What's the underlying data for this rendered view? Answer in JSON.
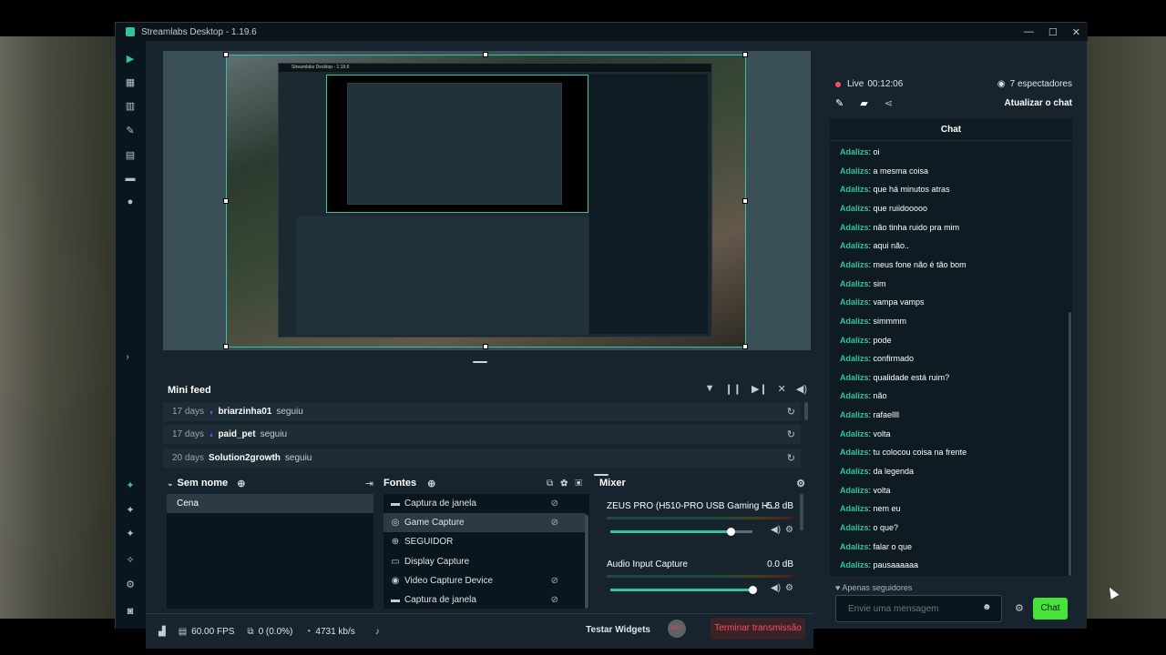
{
  "window": {
    "title": "Streamlabs Desktop - 1.19.6",
    "controls": {
      "minimize": "—",
      "maximize": "☐",
      "close": "✕"
    }
  },
  "leftnav": {
    "top_icons": [
      "editor-icon",
      "themes-icon",
      "layout-icon",
      "alertbox-icon",
      "store-icon",
      "studio-icon",
      "play-icon"
    ],
    "bottom_icons": [
      "stream-settings-icon",
      "multistream-icon",
      "recording-icon",
      "highlighter-icon",
      "settings-icon",
      "profile-icon"
    ]
  },
  "minifeed": {
    "title": "Mini feed",
    "tools": [
      "filter-icon",
      "pause-icon",
      "skip-icon",
      "mute-icon",
      "volume-icon"
    ],
    "rows": [
      {
        "days": "17 days",
        "name": "briarzinha01",
        "action": "seguiu"
      },
      {
        "days": "17 days",
        "name": "paid_pet",
        "action": "seguiu"
      },
      {
        "days": "20 days",
        "name": "Solution2growth",
        "action": "seguiu"
      }
    ]
  },
  "scenes": {
    "title": "Sem nome",
    "items": [
      "Cena"
    ]
  },
  "sources": {
    "title": "Fontes",
    "items": [
      {
        "label": "Captura de janela",
        "icon": "window-icon",
        "hidden": true
      },
      {
        "label": "Game Capture",
        "icon": "gamepad-icon",
        "hidden": true
      },
      {
        "label": "SEGUIDOR",
        "icon": "globe-icon",
        "hidden": false
      },
      {
        "label": "Display Capture",
        "icon": "monitor-icon",
        "hidden": false
      },
      {
        "label": "Video Capture Device",
        "icon": "webcam-icon",
        "hidden": true
      },
      {
        "label": "Captura de janela",
        "icon": "window-icon",
        "hidden": true
      }
    ]
  },
  "mixer": {
    "title": "Mixer",
    "channels": [
      {
        "name": "ZEUS PRO (H510-PRO USB Gaming H...",
        "db": "-5.8 dB",
        "level": 0.85
      },
      {
        "name": "Audio Input Capture",
        "db": "0.0 dB",
        "level": 1.0
      }
    ]
  },
  "statusbar": {
    "fps": "60.00 FPS",
    "dropped": "0 (0.0%)",
    "bitrate": "4731 kb/s",
    "testar_widgets": "Testar Widgets",
    "rec_label": "REC",
    "stop_stream": "Terminar transmissão"
  },
  "chat_panel": {
    "live_label": "Live",
    "live_time": "00:12:06",
    "viewers": "7 espectadores",
    "refresh_label": "Atualizar o chat",
    "chat_title": "Chat",
    "messages": [
      {
        "user": "Adalizs",
        "text": ": oi"
      },
      {
        "user": "Adalizs",
        "text": ": a mesma coisa"
      },
      {
        "user": "Adalizs",
        "text": ": que há minutos atras"
      },
      {
        "user": "Adalizs",
        "text": ": que ruiidooooo"
      },
      {
        "user": "Adalizs",
        "text": ": não tinha ruido pra mim"
      },
      {
        "user": "Adalizs",
        "text": ": aqui não.."
      },
      {
        "user": "Adalizs",
        "text": ": meus fone não é tão bom"
      },
      {
        "user": "Adalizs",
        "text": ": sim"
      },
      {
        "user": "Adalizs",
        "text": ": vampa vamps"
      },
      {
        "user": "Adalizs",
        "text": ": simmmm"
      },
      {
        "user": "Adalizs",
        "text": ": pode"
      },
      {
        "user": "Adalizs",
        "text": ": confirmado"
      },
      {
        "user": "Adalizs",
        "text": ": qualidade está ruim?"
      },
      {
        "user": "Adalizs",
        "text": ": não"
      },
      {
        "user": "Adalizs",
        "text": ": rafaellll"
      },
      {
        "user": "Adalizs",
        "text": ": volta"
      },
      {
        "user": "Adalizs",
        "text": ": tu colocou coisa na frente"
      },
      {
        "user": "Adalizs",
        "text": ": da legenda"
      },
      {
        "user": "Adalizs",
        "text": ": volta"
      },
      {
        "user": "Adalizs",
        "text": ": nem eu"
      },
      {
        "user": "Adalizs",
        "text": ": o que?"
      },
      {
        "user": "Adalizs",
        "text": ": falar o que"
      },
      {
        "user": "Adalizs",
        "text": ": pausaaaaaa"
      }
    ],
    "followers_only": "Apenas seguidores",
    "input_placeholder": "Envie uma mensagem",
    "send_label": "Chat"
  },
  "colors": {
    "accent": "#31c3a2",
    "live_red": "#fb4e5c",
    "chat_send": "#47e33b",
    "twitch_purple": "#9146ff"
  }
}
